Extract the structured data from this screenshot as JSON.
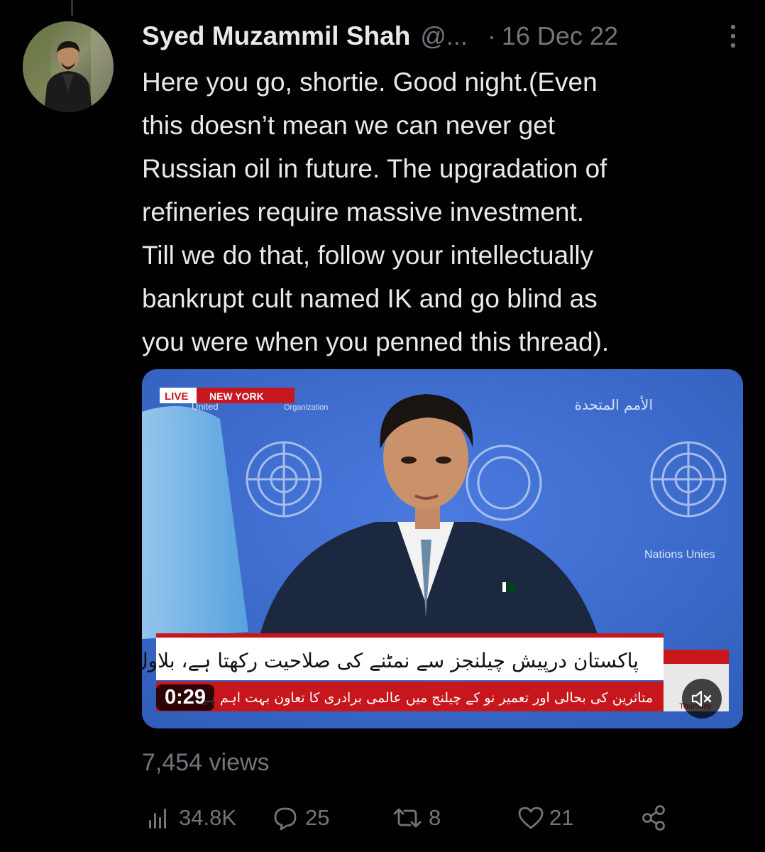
{
  "tweet": {
    "author": {
      "display_name": "Syed Muzammil Shah",
      "handle": "@...",
      "avatar_icon": "profile-photo"
    },
    "separator": "·",
    "date": "16 Dec 22",
    "text": "Here you go, shortie. Good night.(Even this doesn’t mean we can never get Russian oil in future. The upgradation of refineries require massive investment. Till we do that, follow your intellectually bankrupt cult named IK and go blind as you were when you penned this thread).",
    "text_lines": [
      "Here you go, shortie. Good night.(Even",
      "this doesn’t mean we can never get",
      "Russian oil in future. The upgradation of",
      "refineries require massive investment.",
      "Till we do that, follow your intellectually",
      "bankrupt cult named IK and go blind as",
      "you were when you penned this thread)."
    ],
    "video": {
      "duration": "0:29",
      "live_label": "LIVE",
      "location_label": "NEW YORK",
      "backdrop_text_left": "United",
      "backdrop_text_mid": "Organization",
      "backdrop_text_arabic": "الأمم المتحدة",
      "backdrop_text_right": "Nations Unies",
      "headline_urdu": "پاکستان درپیش چیلنجز سے نمٹنے کی صلاحیت رکھتا ہے، بلاول بھٹو",
      "ticker_urdu": "متاثرین کی بحالی اور تعمیر نو کے چیلنج میں عالمی برادری کا تعاون بہت اہم ہے",
      "channel_tag": "Thursday",
      "mute_icon": "speaker-muted-icon"
    },
    "views": "7,454 views",
    "actions": {
      "analytics": "34.8K",
      "replies": "25",
      "retweets": "8",
      "likes": "21"
    }
  },
  "colors": {
    "background": "#000000",
    "primary_text": "#e7e9ea",
    "secondary_text": "#71767b",
    "un_blue": "#3f6fcf",
    "news_red": "#c8161d"
  }
}
